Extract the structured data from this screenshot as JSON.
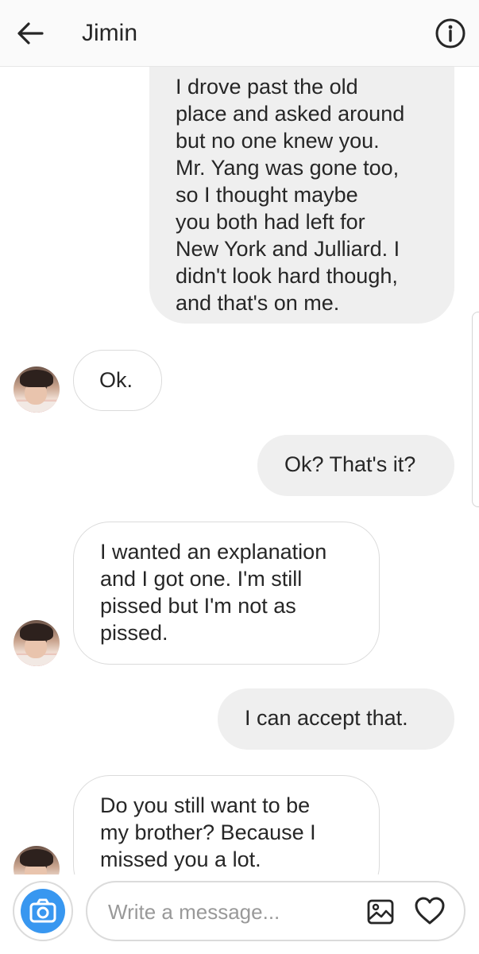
{
  "header": {
    "title": "Jimin",
    "back_icon": "arrow-left-icon",
    "info_icon": "info-circle-icon"
  },
  "messages": [
    {
      "direction": "outgoing",
      "text": "I drove past the old\nplace and asked around\nbut no one knew you.\nMr. Yang was gone too,\nso I thought maybe\nyou both had left for\nNew York and Julliard. I\ndidn't look hard though,\nand that's on me."
    },
    {
      "direction": "incoming",
      "text": "Ok."
    },
    {
      "direction": "outgoing",
      "text": "Ok? That's it?"
    },
    {
      "direction": "incoming",
      "text": "I wanted an explanation\nand I got one. I'm still\npissed but I'm not as\npissed."
    },
    {
      "direction": "outgoing",
      "text": "I can accept that."
    },
    {
      "direction": "incoming",
      "text": "Do you still want to be\nmy brother? Because I\nmissed you a lot."
    }
  ],
  "composer": {
    "placeholder": "Write a message...",
    "camera_icon": "camera-icon",
    "gallery_icon": "image-gallery-icon",
    "heart_icon": "heart-icon",
    "accent_color": "#3897f0"
  }
}
